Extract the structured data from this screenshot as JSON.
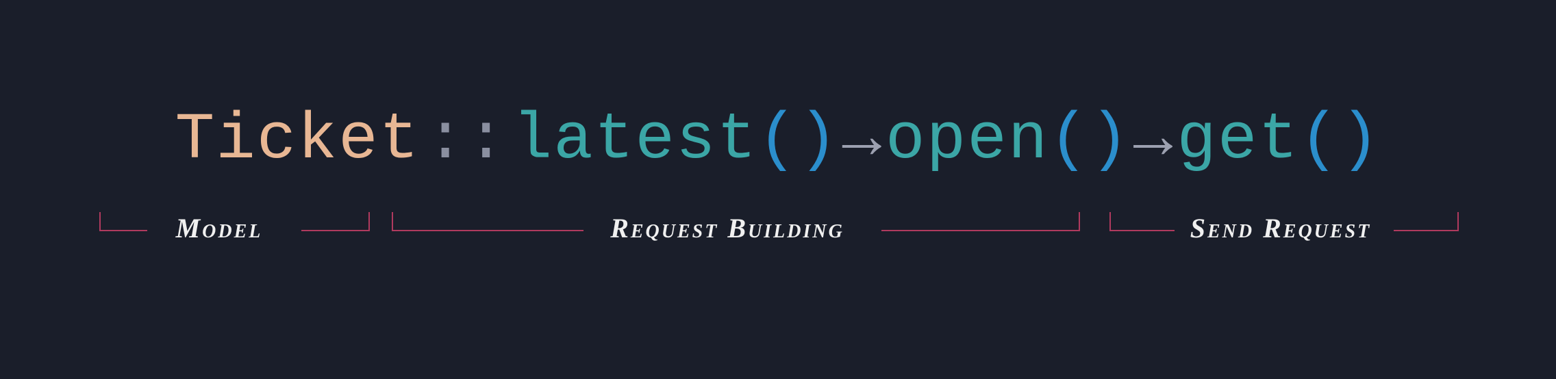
{
  "code": {
    "model": "Ticket",
    "scope_operator": "::",
    "method_1": "latest",
    "parens_1": "()",
    "arrow_1": "→",
    "method_2": "open",
    "parens_2": "()",
    "arrow_2": "→",
    "method_3": "get",
    "parens_3": "()"
  },
  "annotations": {
    "label_1": "Model",
    "label_2": "Request Building",
    "label_3": "Send Request"
  },
  "colors": {
    "background": "#1a1e2a",
    "model": "#e8b794",
    "scope": "#8a8fa0",
    "method": "#3ba6a6",
    "parens": "#2b8ecc",
    "arrow": "#9ca0b0",
    "bracket": "#b03a5e",
    "label": "#f0f0f0"
  }
}
